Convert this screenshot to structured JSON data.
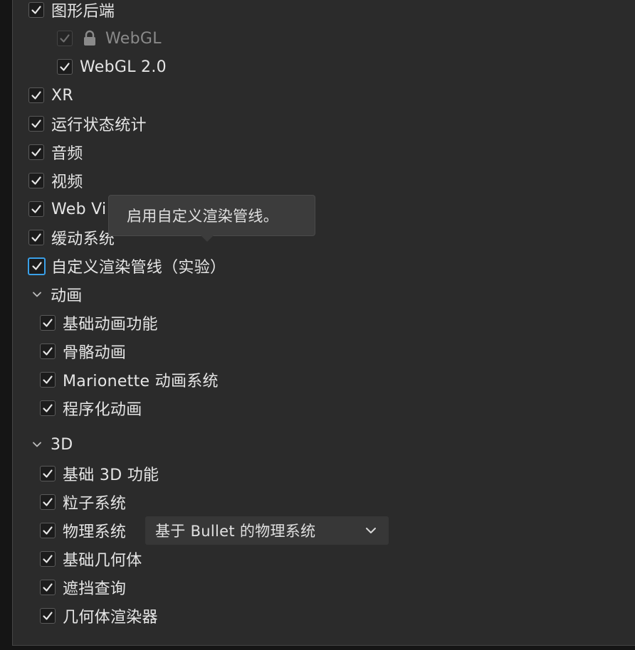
{
  "items": {
    "graphics_backend": "图形后端",
    "webgl": "WebGL",
    "webgl2": "WebGL 2.0",
    "xr": "XR",
    "runtime_stats": "运行状态统计",
    "audio": "音频",
    "video": "视频",
    "webview": "Web Vi",
    "tween": "缓动系统",
    "custom_pipeline": "自定义渲染管线（实验）"
  },
  "animation_section": {
    "title": "动画",
    "items": {
      "basic": "基础动画功能",
      "skeletal": "骨骼动画",
      "marionette": "Marionette 动画系统",
      "procedural": "程序化动画"
    }
  },
  "three_d_section": {
    "title": "3D",
    "items": {
      "basic3d": "基础 3D 功能",
      "particle": "粒子系统",
      "physics": "物理系统",
      "geometry": "基础几何体",
      "occlusion": "遮挡查询",
      "geometry_renderer": "几何体渲染器"
    },
    "physics_select_value": "基于 Bullet 的物理系统"
  },
  "tooltip": "启用自定义渲染管线。",
  "icons": {
    "check": "checkmark-icon",
    "lock": "lock-icon",
    "caret": "chevron-down-icon"
  },
  "colors": {
    "focus_ring": "#3aa0e8",
    "panel_bg": "#2b2b2b"
  }
}
